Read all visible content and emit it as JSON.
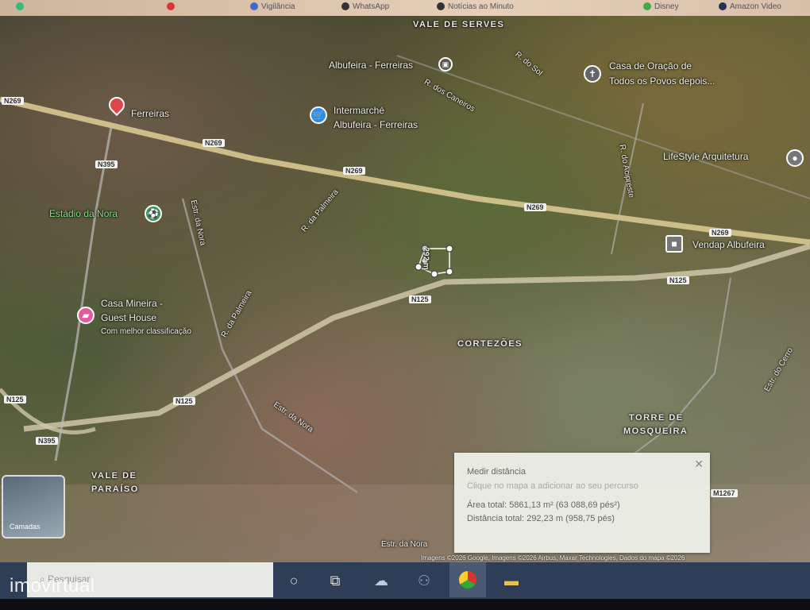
{
  "bookmarks": [
    {
      "label": "",
      "color": "#3b7"
    },
    {
      "label": "",
      "color": "#d33"
    },
    {
      "label": "Vigilância",
      "color": "#46c"
    },
    {
      "label": "WhatsApp",
      "color": "#333"
    },
    {
      "label": "Notícias ao Minuto",
      "color": "#333"
    },
    {
      "label": "Disney",
      "color": "#4a4"
    },
    {
      "label": "Amazon Video",
      "color": "#235"
    }
  ],
  "map": {
    "place_labels": {
      "vale_de_serves": "VALE DE SERVES",
      "albufeira_ferreiras": "Albufeira - Ferreiras",
      "r_dos_caneiros": "R. dos Caneiros",
      "r_do_sol": "R. do Sol",
      "casa_oracao": "Casa de Oração de",
      "casa_oracao_2": "Todos os Povos depois...",
      "ferreiras": "Ferreiras",
      "intermarche": "Intermarché",
      "intermarche_2": "Albufeira - Ferreiras",
      "lifestyle": "LifeStyle Arquitetura",
      "r_do_acipreste": "R. do Acipreste",
      "estadio": "Estádio da Nora",
      "estr_da_nora": "Estr. da Nora",
      "estr_da_nora_2": "Estr. da Nora",
      "estr_da_nora_3": "Estr. da Nora",
      "r_da_palmeira": "R. da Palmeira",
      "r_da_palmeira_2": "R. da Palmeira",
      "vendap": "Vendap Albufeira",
      "casa_mineira": "Casa Mineira -",
      "casa_mineira_2": "Guest House",
      "casa_mineira_sub": "Com melhor classificação",
      "cortezoes": "CORTEZÕES",
      "torre": "TORRE DE",
      "torre_2": "MOSQUEIRA",
      "vale_paraiso": "VALE DE",
      "vale_paraiso_2": "PARAÍSO",
      "estr_do_cerro": "Estr. do Cerro",
      "segment_label": "292 m"
    },
    "roads": {
      "n269_a": "N269",
      "n269_b": "N269",
      "n269_c": "N269",
      "n269_d": "N269",
      "n395": "N395",
      "n125_a": "N125",
      "n125_b": "N125",
      "n125_c": "N125",
      "n125_d": "N125",
      "n395_b": "N395",
      "m1267": "M1267"
    },
    "layers_label": "Camadas",
    "attribution": "Imagens ©2026 Google, Imagens ©2026 Airbus, Maxar Technologies, Dados do mapa ©2026"
  },
  "measure": {
    "title": "Medir distância",
    "hint": "Clique no mapa a adicionar ao seu percurso",
    "area": "Área total: 5861,13 m² (63 088,69 pés²)",
    "distance": "Distância total: 292,23 m (958,75 pés)"
  },
  "taskbar": {
    "search_placeholder": "Pesquisar"
  },
  "watermark": "imovirtual"
}
